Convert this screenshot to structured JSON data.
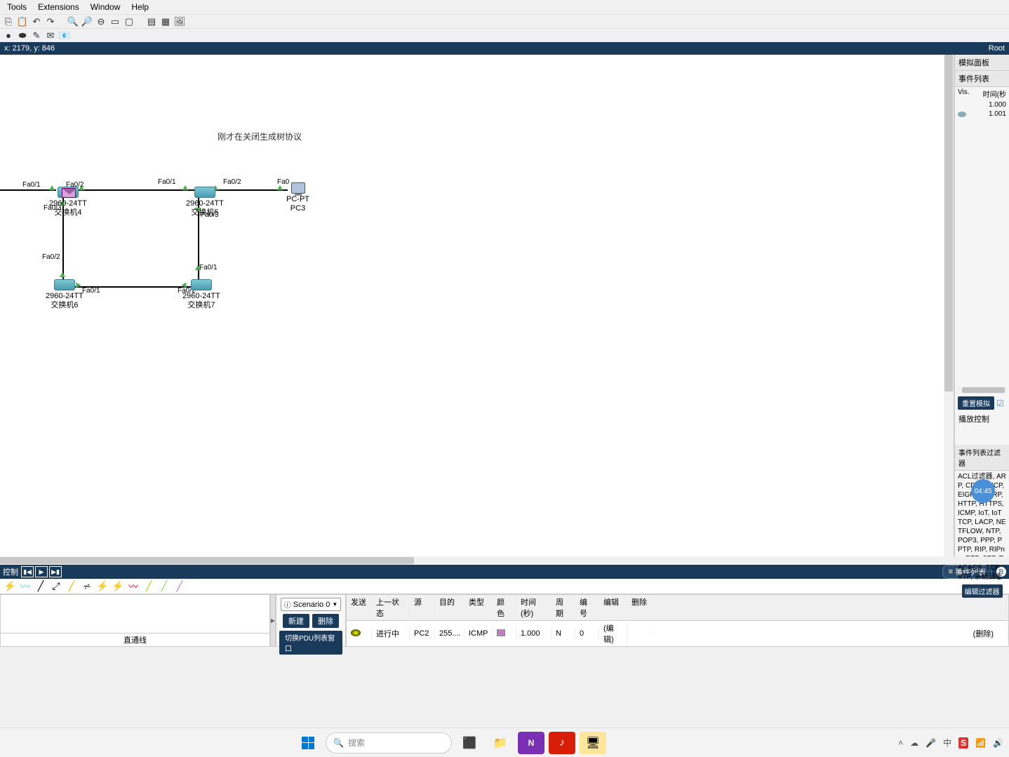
{
  "menubar": [
    "Tools",
    "Extensions",
    "Window",
    "Help"
  ],
  "coords": {
    "label": "x: 2179, y: 846",
    "root": "Root"
  },
  "canvas_note": "刚才在关闭生成树协议",
  "devices": {
    "sw4": {
      "name": "2960-24TT",
      "label": "交换机4"
    },
    "sw5": {
      "name": "2960-24TT",
      "label": "交换机5"
    },
    "sw6": {
      "name": "2960-24TT",
      "label": "交换机6"
    },
    "sw7": {
      "name": "2960-24TT",
      "label": "交换机7"
    },
    "pc3": {
      "name": "PC-PT",
      "label": "PC3"
    }
  },
  "ports": {
    "p1": "Fa0/1",
    "p2": "Fa0/2",
    "p3": "Fa0/3",
    "p0": "Fa0"
  },
  "sim": {
    "title": "模拟面板",
    "eventlist": "事件列表",
    "vis": "Vis.",
    "time": "时间(秒",
    "rows": [
      {
        "t": "1.000"
      },
      {
        "t": "1.001"
      }
    ],
    "reset": "重置模拟",
    "playctrl": "播放控制",
    "filter_title": "事件列表过滤器",
    "filter_text": "ACL过滤器, ARP, CDP, DHCP, EIGRP, HSRP, HTTP, HTTPS, ICMP, IoT, IoT TCP, LACP, NETFLOW, NTP, POP3, PPP, PPTP, RIP, RIPng, RTP, STP, TACACS, TCP, VTP, 系统日志",
    "edit_filter": "编辑过滤器",
    "clock": "04:45"
  },
  "playbar": {
    "ctrl": "控制",
    "eventlist": "事件列表",
    "rt": "R"
  },
  "scenario": {
    "label": "Scenario 0",
    "new": "新建",
    "delete": "删除",
    "toggle": "切换PDU列表窗口"
  },
  "pdu": {
    "headers": [
      "发送",
      "上一状态",
      "源",
      "目的",
      "类型",
      "颜色",
      "时间(秒)",
      "周期",
      "编号",
      "编辑",
      "删除"
    ],
    "row": {
      "status": "进行中",
      "src": "PC2",
      "dst": "255....",
      "type": "ICMP",
      "time": "1.000",
      "period": "N",
      "num": "0",
      "edit": "(编辑)",
      "delete_all": "(删除)"
    }
  },
  "device_preview_label": "直通线",
  "taskbar": {
    "search": "搜索"
  }
}
